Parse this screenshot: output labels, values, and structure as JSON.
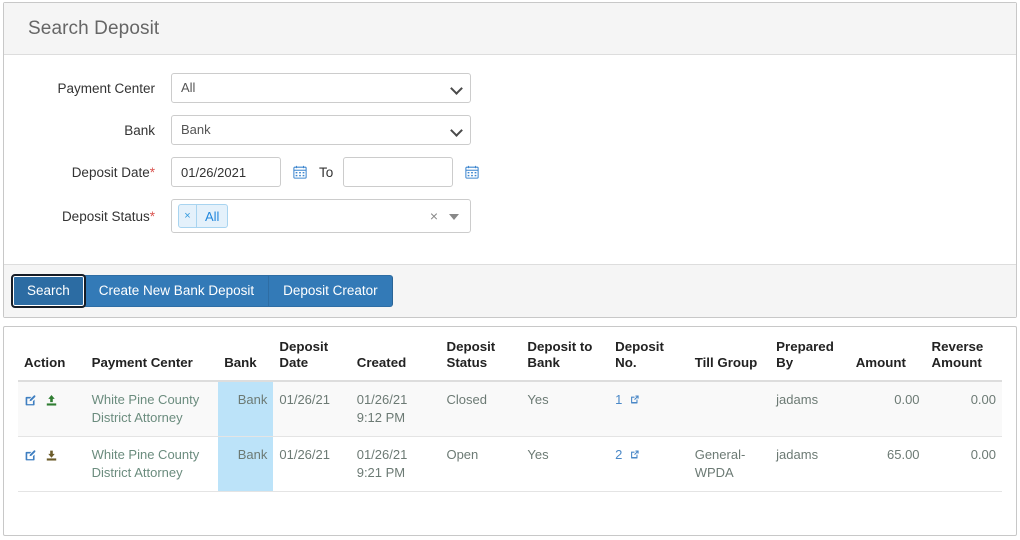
{
  "search_panel": {
    "title": "Search Deposit",
    "fields": {
      "payment_center": {
        "label": "Payment Center",
        "value": "All",
        "options": [
          "All"
        ]
      },
      "bank": {
        "label": "Bank",
        "value": "Bank",
        "options": [
          "Bank"
        ]
      },
      "deposit_date": {
        "label": "Deposit Date",
        "required_mark": "*",
        "from_value": "01/26/2021",
        "to_label": "To",
        "to_value": "",
        "calendar_icon": "calendar-icon"
      },
      "deposit_status": {
        "label": "Deposit Status",
        "required_mark": "*",
        "tag_label": "All",
        "tag_remove": "×",
        "clear_all": "×",
        "dropdown_icon": "caret-down-icon"
      }
    },
    "buttons": {
      "search": "Search",
      "create_new_bank_deposit": "Create New Bank Deposit",
      "deposit_creator": "Deposit Creator"
    }
  },
  "results": {
    "columns": [
      "Action",
      "Payment Center",
      "Bank",
      "Deposit Date",
      "Created",
      "Deposit Status",
      "Deposit to Bank",
      "Deposit No.",
      "Till Group",
      "Prepared By",
      "Amount",
      "Reverse Amount"
    ],
    "rows": [
      {
        "action_icons": [
          "edit-icon",
          "upload-icon"
        ],
        "payment_center": "White Pine County District Attorney",
        "bank": "Bank",
        "deposit_date": "01/26/21",
        "created": "01/26/21 9:12 PM",
        "deposit_status": "Closed",
        "deposit_to_bank": "Yes",
        "deposit_no": "1",
        "deposit_no_icon": "external-link-icon",
        "till_group": "",
        "prepared_by": "jadams",
        "amount": "0.00",
        "reverse_amount": "0.00"
      },
      {
        "action_icons": [
          "edit-icon",
          "download-icon"
        ],
        "payment_center": "White Pine County District Attorney",
        "bank": "Bank",
        "deposit_date": "01/26/21",
        "created": "01/26/21 9:21 PM",
        "deposit_status": "Open",
        "deposit_to_bank": "Yes",
        "deposit_no": "2",
        "deposit_no_icon": "external-link-icon",
        "till_group": "General-WPDA",
        "prepared_by": "jadams",
        "amount": "65.00",
        "reverse_amount": "0.00"
      }
    ]
  },
  "colors": {
    "primary_button": "#337ab7",
    "bank_cell_highlight": "#bce3f9",
    "link": "#4a88c7",
    "required_mark": "#d9534f",
    "upload_icon": "#2f7d32",
    "download_icon": "#6b5b2a",
    "edit_icon": "#3f7fc1"
  }
}
